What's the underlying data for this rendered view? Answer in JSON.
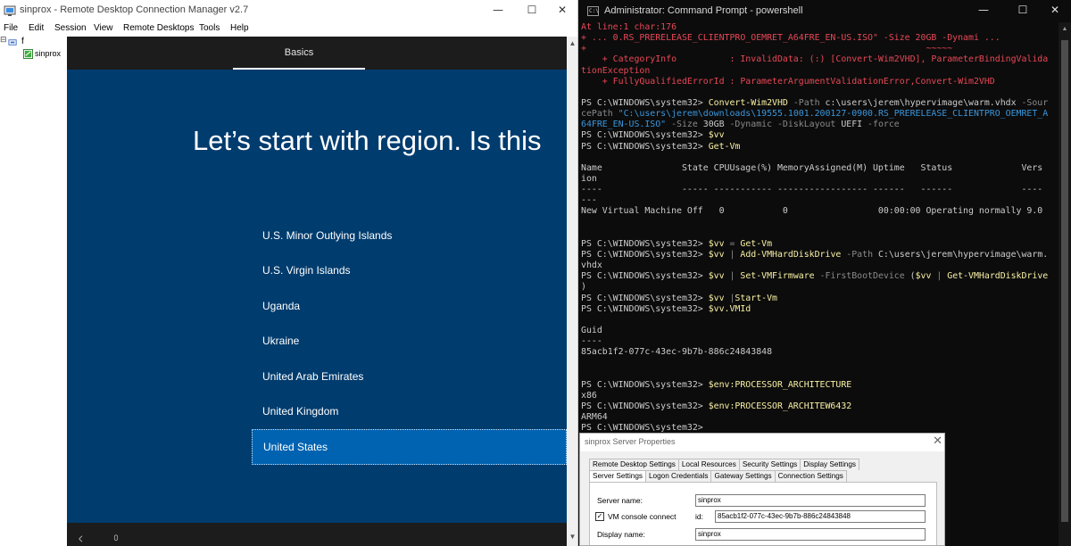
{
  "rdcman": {
    "title": "sinprox - Remote Desktop Connection Manager v2.7",
    "menu": [
      "File",
      "Edit",
      "Session",
      "View",
      "Remote Desktops",
      "Tools",
      "Help"
    ],
    "tree": {
      "group": "f",
      "server": "sinprox"
    },
    "oobe": {
      "step": "Basics",
      "heading": "Let’s start with region. Is this",
      "regions": [
        {
          "label": "U.S. Minor Outlying Islands",
          "selected": false
        },
        {
          "label": "U.S. Virgin Islands",
          "selected": false
        },
        {
          "label": "Uganda",
          "selected": false
        },
        {
          "label": "Ukraine",
          "selected": false
        },
        {
          "label": "United Arab Emirates",
          "selected": false
        },
        {
          "label": "United Kingdom",
          "selected": false
        },
        {
          "label": "United States",
          "selected": true
        }
      ]
    }
  },
  "powershell": {
    "title": "Administrator: Command Prompt - powershell",
    "icon_text": "C:\\",
    "lines": [
      [
        [
          "At line:1 char:176",
          "red"
        ]
      ],
      [
        [
          "+ ... 0.RS_PRERELEASE_CLIENTPRO_OEMRET_A64FRE_EN-US.ISO\" -Size 20GB -Dynami ...",
          "red"
        ]
      ],
      [
        [
          "+                                                                ~~~~~",
          "red"
        ]
      ],
      [
        [
          "    + CategoryInfo          : InvalidData: (:) [Convert-Wim2VHD], ParameterBindingValida",
          "red"
        ]
      ],
      [
        [
          "tionException",
          "red"
        ]
      ],
      [
        [
          "    + FullyQualifiedErrorId : ParameterArgumentValidationError,Convert-Wim2VHD",
          "red"
        ]
      ],
      [
        [
          "",
          "w"
        ]
      ],
      [
        [
          "PS C:\\WINDOWS\\system32> ",
          "w"
        ],
        [
          "Convert-Wim2VHD",
          "y"
        ],
        [
          " -Path ",
          "g"
        ],
        [
          "c:\\users\\jerem\\hypervimage\\warm.vhdx",
          "w"
        ],
        [
          " -Sour",
          "g"
        ]
      ],
      [
        [
          "cePath ",
          "g"
        ],
        [
          "\"C:\\users\\jerem\\downloads\\19555.1001.200127-0900.RS_PRERELEASE_CLIENTPRO_OEMRET_A",
          "b"
        ]
      ],
      [
        [
          "64FRE_EN-US.ISO\"",
          "b"
        ],
        [
          " -Size ",
          "g"
        ],
        [
          "30GB",
          "w"
        ],
        [
          " -Dynamic -DiskLayout ",
          "g"
        ],
        [
          "UEFI",
          "w"
        ],
        [
          " -force",
          "g"
        ]
      ],
      [
        [
          "PS C:\\WINDOWS\\system32> ",
          "w"
        ],
        [
          "$vv",
          "y"
        ]
      ],
      [
        [
          "PS C:\\WINDOWS\\system32> ",
          "w"
        ],
        [
          "Get-Vm",
          "y"
        ]
      ],
      [
        [
          "",
          "w"
        ]
      ],
      [
        [
          "Name               State CPUUsage(%) MemoryAssigned(M) Uptime   Status             Vers",
          "w"
        ]
      ],
      [
        [
          "ion",
          "w"
        ]
      ],
      [
        [
          "----               ----- ----------- ----------------- ------   ------             ----",
          "w"
        ]
      ],
      [
        [
          "---",
          "w"
        ]
      ],
      [
        [
          "New Virtual Machine Off   0           0                 00:00:00 Operating normally 9.0",
          "w"
        ]
      ],
      [
        [
          "",
          "w"
        ]
      ],
      [
        [
          "",
          "w"
        ]
      ],
      [
        [
          "PS C:\\WINDOWS\\system32> ",
          "w"
        ],
        [
          "$vv",
          "y"
        ],
        [
          " = ",
          "g"
        ],
        [
          "Get-Vm",
          "y"
        ]
      ],
      [
        [
          "PS C:\\WINDOWS\\system32> ",
          "w"
        ],
        [
          "$vv",
          "y"
        ],
        [
          " | ",
          "g"
        ],
        [
          "Add-VMHardDiskDrive",
          "y"
        ],
        [
          " -Path ",
          "g"
        ],
        [
          "C:\\users\\jerem\\hypervimage\\warm.",
          "w"
        ]
      ],
      [
        [
          "vhdx",
          "w"
        ]
      ],
      [
        [
          "PS C:\\WINDOWS\\system32> ",
          "w"
        ],
        [
          "$vv",
          "y"
        ],
        [
          " | ",
          "g"
        ],
        [
          "Set-VMFirmware",
          "y"
        ],
        [
          " -FirstBootDevice ",
          "g"
        ],
        [
          "(",
          "w"
        ],
        [
          "$vv",
          "y"
        ],
        [
          " | ",
          "g"
        ],
        [
          "Get-VMHardDiskDrive",
          "y"
        ]
      ],
      [
        [
          ")",
          "w"
        ]
      ],
      [
        [
          "PS C:\\WINDOWS\\system32> ",
          "w"
        ],
        [
          "$vv",
          "y"
        ],
        [
          " |",
          "g"
        ],
        [
          "Start-Vm",
          "y"
        ]
      ],
      [
        [
          "PS C:\\WINDOWS\\system32> ",
          "w"
        ],
        [
          "$vv.VMId",
          "y"
        ]
      ],
      [
        [
          "",
          "w"
        ]
      ],
      [
        [
          "Guid",
          "w"
        ]
      ],
      [
        [
          "----",
          "w"
        ]
      ],
      [
        [
          "85acb1f2-077c-43ec-9b7b-886c24843848",
          "w"
        ]
      ],
      [
        [
          "",
          "w"
        ]
      ],
      [
        [
          "",
          "w"
        ]
      ],
      [
        [
          "PS C:\\WINDOWS\\system32> ",
          "w"
        ],
        [
          "$env:PROCESSOR_ARCHITECTURE",
          "y"
        ]
      ],
      [
        [
          "x86",
          "w"
        ]
      ],
      [
        [
          "PS C:\\WINDOWS\\system32> ",
          "w"
        ],
        [
          "$env:PROCESSOR_ARCHITEW6432",
          "y"
        ]
      ],
      [
        [
          "ARM64",
          "w"
        ]
      ],
      [
        [
          "PS C:\\WINDOWS\\system32>",
          "w"
        ]
      ]
    ]
  },
  "server_props": {
    "title": "sinprox Server Properties",
    "tabs_row1": [
      "Remote Desktop Settings",
      "Local Resources",
      "Security Settings",
      "Display Settings"
    ],
    "tabs_row2": [
      "Server Settings",
      "Logon Credentials",
      "Gateway Settings",
      "Connection Settings"
    ],
    "active_tab": "Server Settings",
    "server_name_label": "Server name:",
    "server_name_value": "sinprox",
    "vm_console_label": "VM console connect",
    "vm_console_checked": true,
    "id_label": "id:",
    "id_value": "85acb1f2-077c-43ec-9b7b-886c24843848",
    "display_name_label": "Display name:",
    "display_name_value": "sinprox"
  },
  "colors": {
    "oobe_background": "#003c6e",
    "oobe_selection": "#0063b1",
    "ps_background": "#0c0c0c",
    "ps_error": "#e74856",
    "ps_command": "#f9f1a5",
    "ps_string": "#3a96dd"
  },
  "icons": {
    "window_minimize": "—",
    "window_maximize": "☐",
    "window_close": "✕",
    "tree_expand": "⊟",
    "checkmark": "✓",
    "scroll_up": "▲",
    "scroll_down": "▼"
  }
}
